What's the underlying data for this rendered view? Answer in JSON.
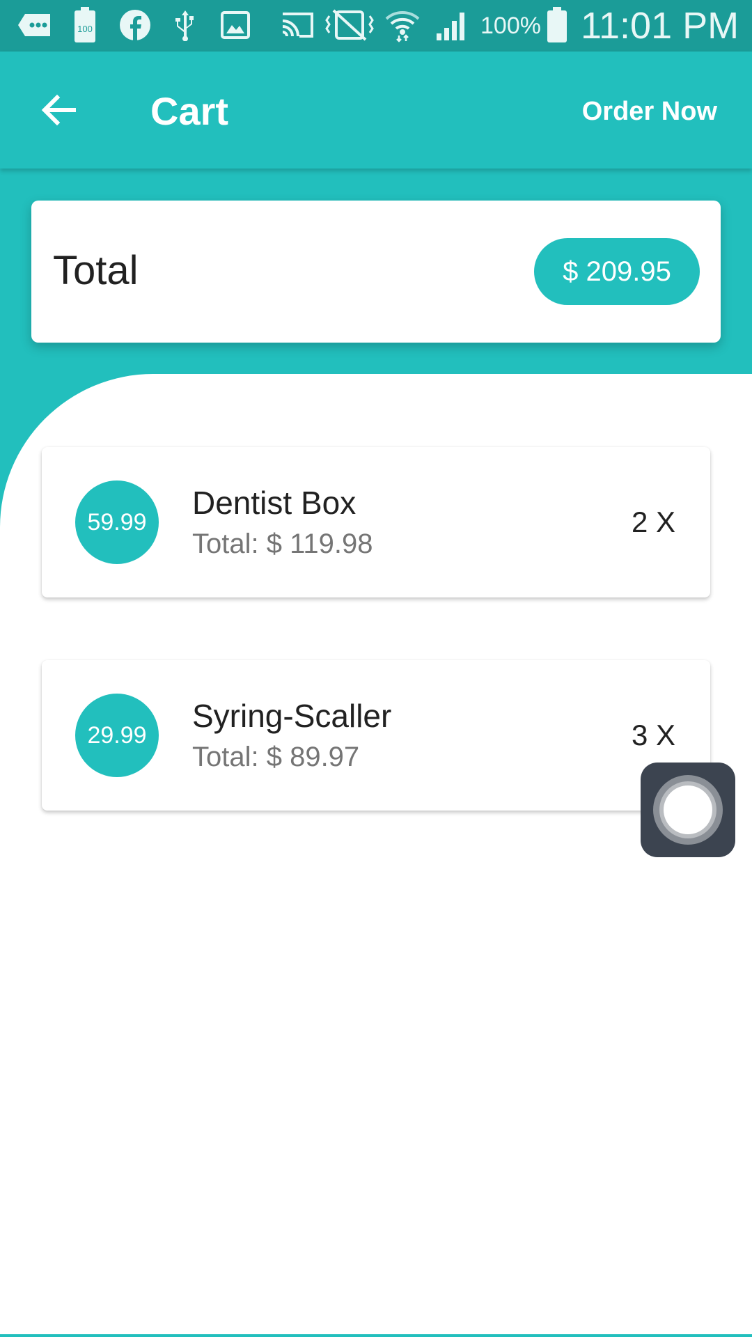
{
  "status_bar": {
    "battery_percent": "100%",
    "time": "11:01 PM",
    "icons": [
      "message-icon",
      "battery-saver-icon",
      "facebook-icon",
      "usb-icon",
      "image-icon",
      "cast-icon",
      "vibrate-off-icon",
      "wifi-icon",
      "signal-icon",
      "battery-icon"
    ],
    "battery_saver_label": "100"
  },
  "app_bar": {
    "title": "Cart",
    "action_label": "Order Now",
    "back_icon": "arrow-back-icon"
  },
  "summary": {
    "label": "Total",
    "amount": "$ 209.95"
  },
  "cart": {
    "items": [
      {
        "price": "59.99",
        "name": "Dentist Box",
        "total": "Total: $ 119.98",
        "quantity": "2 X"
      },
      {
        "price": "29.99",
        "name": "Syring-Scaller",
        "total": "Total: $ 89.97",
        "quantity": "3 X"
      }
    ]
  },
  "colors": {
    "primary": "#22bfbd",
    "status_bar": "#1b9c98",
    "text_primary": "#212121",
    "text_secondary": "#757575"
  }
}
